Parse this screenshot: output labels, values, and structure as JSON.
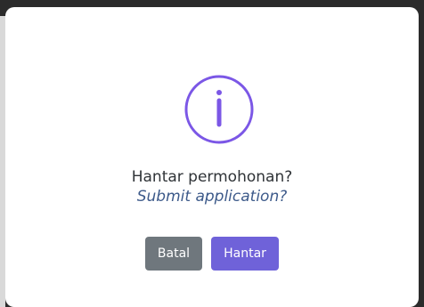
{
  "dialog": {
    "icon": "info-icon",
    "title": "Hantar permohonan?",
    "subtitle": "Submit application?",
    "buttons": {
      "cancel": "Batal",
      "submit": "Hantar"
    },
    "colors": {
      "accent": "#7b57e6",
      "cancel": "#6f777d",
      "submit": "#6f62d9",
      "title": "#2f3337",
      "subtitle": "#3d5a8a"
    }
  }
}
